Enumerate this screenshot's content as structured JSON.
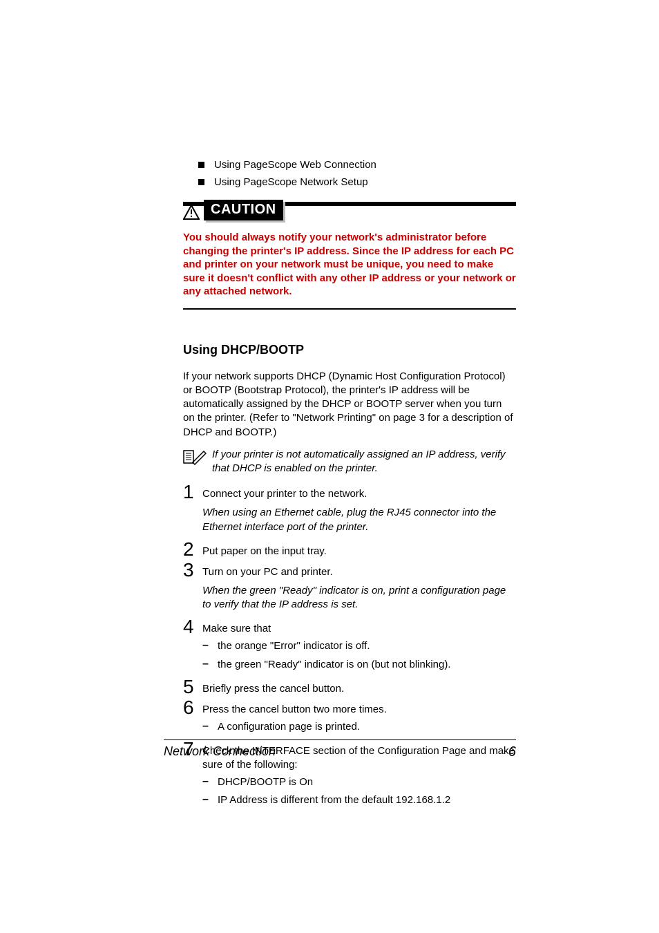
{
  "top_bullets": [
    "Using PageScope Web Connection",
    "Using PageScope Network Setup"
  ],
  "caution": {
    "label": "CAUTION",
    "text": "You should always notify your network's administrator before changing the printer's IP address. Since the IP address for each PC and printer on your network must be unique, you need to make sure it doesn't conflict with any other IP address or your network or any attached network."
  },
  "section_heading": "Using DHCP/BOOTP",
  "intro_para": "If your network supports DHCP (Dynamic Host Configuration Protocol) or BOOTP (Bootstrap Protocol), the printer's IP address will be automatically assigned by the DHCP or BOOTP server when you turn on the printer. (Refer to \"Network Printing\" on page 3 for a description of DHCP and BOOTP.)",
  "note": "If your printer is not automatically assigned an IP address, verify that DHCP is enabled on the printer.",
  "steps": {
    "s1": {
      "num": "1",
      "text": "Connect your printer to the network."
    },
    "s1_sub": "When using an Ethernet cable, plug the RJ45 connector into the Ethernet interface port of the printer.",
    "s2": {
      "num": "2",
      "text": "Put paper on the input tray."
    },
    "s3": {
      "num": "3",
      "text": "Turn on your PC and printer."
    },
    "s3_sub": "When the green \"Ready\" indicator is on, print a configuration page to verify that the IP address is set.",
    "s4": {
      "num": "4",
      "text": "Make sure that"
    },
    "s4_dashes": [
      "the orange \"Error\" indicator is off.",
      "the green \"Ready\" indicator is on (but not blinking)."
    ],
    "s5": {
      "num": "5",
      "text": "Briefly press the cancel button."
    },
    "s6": {
      "num": "6",
      "text": "Press the cancel button two more times."
    },
    "s6_dashes": [
      "A configuration page is printed."
    ],
    "s7": {
      "num": "7",
      "text": "Check the INTERFACE section of the Configuration Page and make sure of the following:"
    },
    "s7_dashes": [
      "DHCP/BOOTP is On",
      "IP Address is different from the default 192.168.1.2"
    ]
  },
  "footer": {
    "title": "Network Connection",
    "page": "6"
  }
}
